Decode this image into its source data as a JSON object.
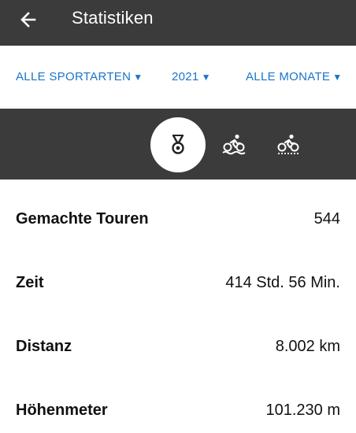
{
  "appbar": {
    "title": "Statistiken",
    "back_icon": "arrow-left-icon",
    "background": "#3b3b3b"
  },
  "filters": {
    "sport": "ALLE SPORTARTEN",
    "year": "2021",
    "month": "ALLE MONATE",
    "caret": "▼",
    "color": "#1b74c9"
  },
  "tabs": [
    {
      "icon": "medal-icon",
      "selected": true
    },
    {
      "icon": "swim-bike-icon",
      "selected": false
    },
    {
      "icon": "cycling-icon",
      "selected": false
    }
  ],
  "stats": [
    {
      "label": "Gemachte Touren",
      "value": "544"
    },
    {
      "label": "Zeit",
      "value": "414 Std. 56 Min."
    },
    {
      "label": "Distanz",
      "value": "8.002 km"
    },
    {
      "label": "Höhenmeter",
      "value": "101.230 m"
    }
  ]
}
